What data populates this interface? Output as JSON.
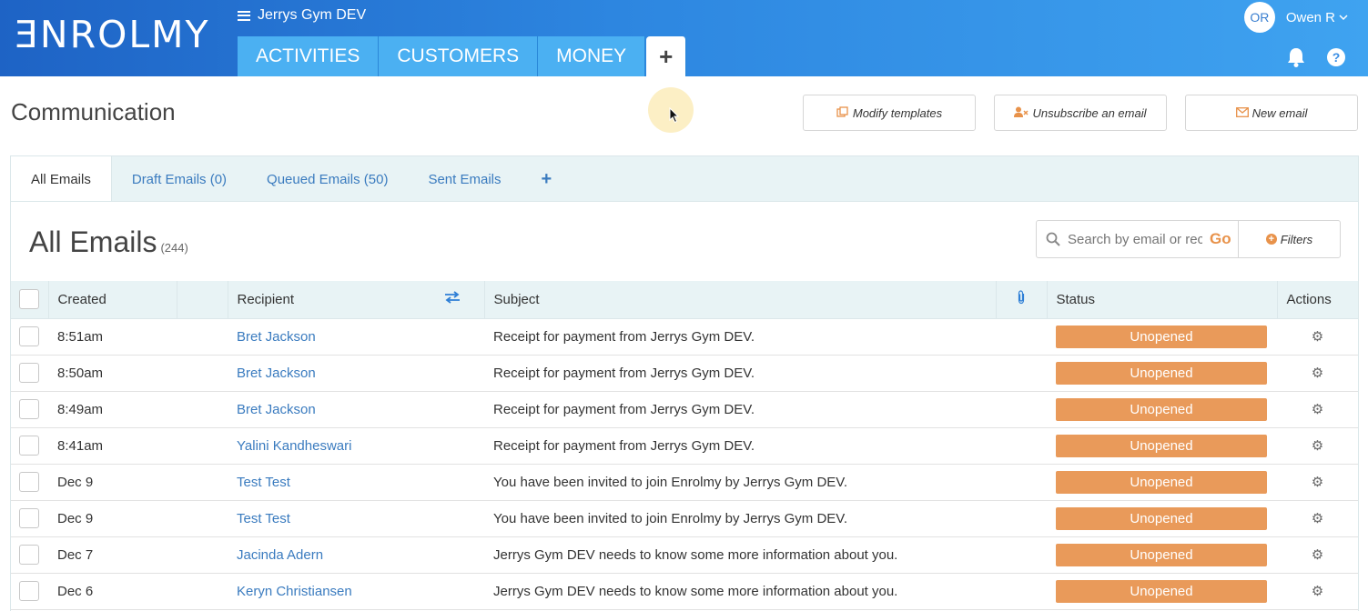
{
  "brand": {
    "logo_text": "ƎNROLMY"
  },
  "header": {
    "org_name": "Jerrys Gym DEV",
    "nav_tabs": [
      {
        "label": "ACTIVITIES"
      },
      {
        "label": "CUSTOMERS"
      },
      {
        "label": "MONEY"
      }
    ],
    "add_tab_label": "+",
    "user": {
      "initials": "OR",
      "name": "Owen R"
    },
    "help_label": "?"
  },
  "page": {
    "title": "Communication",
    "buttons": {
      "modify_templates": "Modify templates",
      "unsubscribe": "Unsubscribe an email",
      "new_email": "New email"
    }
  },
  "tabs": [
    {
      "label": "All Emails",
      "active": true
    },
    {
      "label": "Draft Emails (0)",
      "active": false
    },
    {
      "label": "Queued Emails (50)",
      "active": false
    },
    {
      "label": "Sent Emails",
      "active": false
    }
  ],
  "tabs_add_label": "+",
  "list": {
    "title": "All Emails",
    "count": "(244)",
    "search_placeholder": "Search by email or rec",
    "go_label": "Go",
    "filters_label": "Filters",
    "columns": {
      "created": "Created",
      "recipient": "Recipient",
      "subject": "Subject",
      "status": "Status",
      "actions": "Actions"
    },
    "rows": [
      {
        "created": "8:51am",
        "recipient": "Bret Jackson",
        "subject": "Receipt for payment from Jerrys Gym DEV.",
        "status": "Unopened"
      },
      {
        "created": "8:50am",
        "recipient": "Bret Jackson",
        "subject": "Receipt for payment from Jerrys Gym DEV.",
        "status": "Unopened"
      },
      {
        "created": "8:49am",
        "recipient": "Bret Jackson",
        "subject": "Receipt for payment from Jerrys Gym DEV.",
        "status": "Unopened"
      },
      {
        "created": "8:41am",
        "recipient": "Yalini Kandheswari",
        "subject": "Receipt for payment from Jerrys Gym DEV.",
        "status": "Unopened"
      },
      {
        "created": "Dec 9",
        "recipient": "Test Test",
        "subject": "You have been invited to join Enrolmy by Jerrys Gym DEV.",
        "status": "Unopened"
      },
      {
        "created": "Dec 9",
        "recipient": "Test Test",
        "subject": "You have been invited to join Enrolmy by Jerrys Gym DEV.",
        "status": "Unopened"
      },
      {
        "created": "Dec 7",
        "recipient": "Jacinda Adern",
        "subject": "Jerrys Gym DEV needs to know some more information about you.",
        "status": "Unopened"
      },
      {
        "created": "Dec 6",
        "recipient": "Keryn Christiansen",
        "subject": "Jerrys Gym DEV needs to know some more information about you.",
        "status": "Unopened"
      }
    ]
  },
  "colors": {
    "topbar_start": "#1e63c5",
    "topbar_end": "#3fa3f0",
    "nav_tab": "#4bb0f2",
    "accent_orange": "#e8924a",
    "status_unopened": "#e99a5a",
    "link_blue": "#3a7bbf",
    "tab_bar_bg": "#e8f3f5"
  },
  "icons": {
    "menu": "hamburger-icon",
    "bell": "bell-icon",
    "help": "help-icon",
    "templates": "copy-icon",
    "unsubscribe": "user-remove-icon",
    "new_email": "envelope-icon",
    "search": "search-icon",
    "filters": "plus-circle-icon",
    "swap": "swap-arrows-icon",
    "attachment": "paperclip-icon",
    "gear": "gear-icon"
  }
}
